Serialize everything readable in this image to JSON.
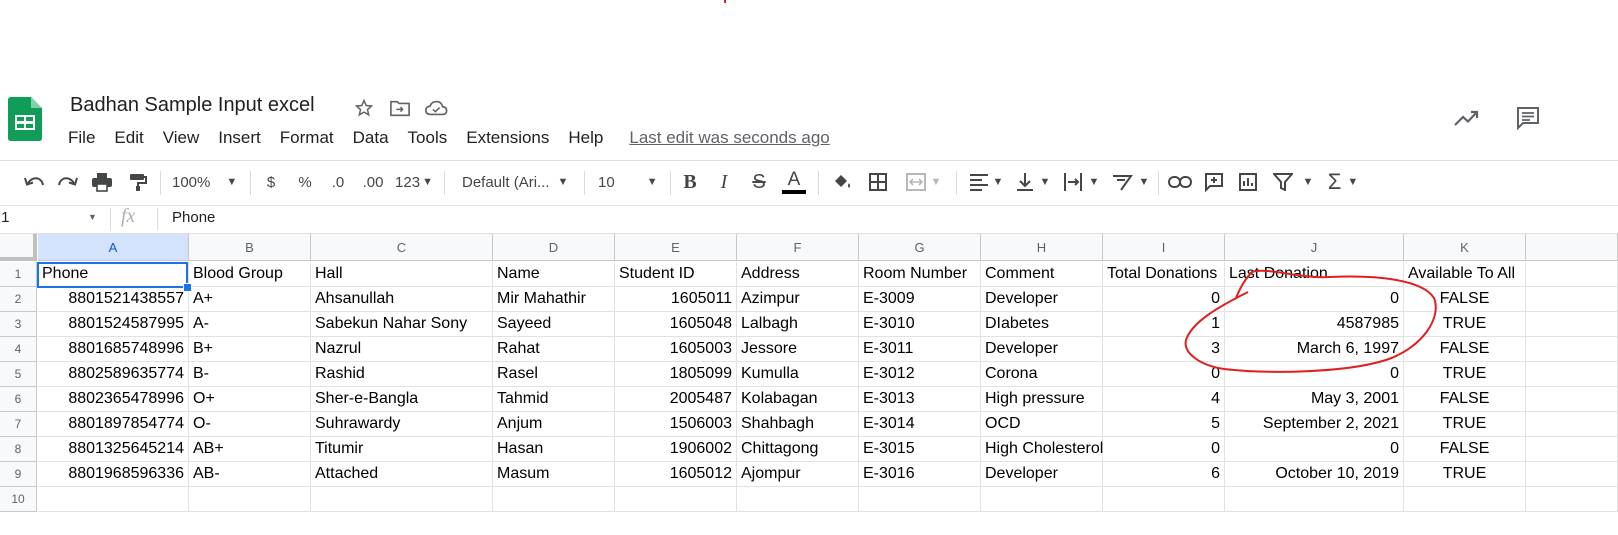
{
  "document": {
    "title": "Badhan Sample Input excel"
  },
  "menu": {
    "items": [
      "File",
      "Edit",
      "View",
      "Insert",
      "Format",
      "Data",
      "Tools",
      "Extensions",
      "Help"
    ],
    "last_edit": "Last edit was seconds ago"
  },
  "toolbar": {
    "zoom": "100%",
    "currency": "$",
    "percent": "%",
    "decrease_decimal": ".0",
    "increase_decimal": ".00",
    "more_formats": "123",
    "font_family": "Default (Ari...",
    "font_size": "10"
  },
  "formula_bar": {
    "cell_ref": ".1",
    "fx": "fx",
    "content": "Phone"
  },
  "grid": {
    "columns": [
      "A",
      "B",
      "C",
      "D",
      "E",
      "F",
      "G",
      "H",
      "I",
      "J",
      "K"
    ],
    "rows": [
      {
        "n": "1",
        "cells": [
          "Phone",
          "Blood Group",
          "Hall",
          "Name",
          "Student ID",
          "Address",
          "Room Number",
          "Comment",
          "Total Donations",
          "Last Donation",
          "Available To All"
        ]
      },
      {
        "n": "2",
        "cells": [
          "8801521438557",
          "A+",
          "Ahsanullah",
          "Mir Mahathir",
          "1605011",
          "Azimpur",
          "E-3009",
          "Developer",
          "0",
          "0",
          "FALSE"
        ]
      },
      {
        "n": "3",
        "cells": [
          "8801524587995",
          "A-",
          "Sabekun Nahar Sony",
          "Sayeed",
          "1605048",
          "Lalbagh",
          "E-3010",
          "DIabetes",
          "1",
          "4587985",
          "TRUE"
        ]
      },
      {
        "n": "4",
        "cells": [
          "8801685748996",
          "B+",
          "Nazrul",
          "Rahat",
          "1605003",
          "Jessore",
          "E-3011",
          "Developer",
          "3",
          "March 6, 1997",
          "FALSE"
        ]
      },
      {
        "n": "5",
        "cells": [
          "8802589635774",
          "B-",
          "Rashid",
          "Rasel",
          "1805099",
          "Kumulla",
          "E-3012",
          "Corona",
          "0",
          "0",
          "TRUE"
        ]
      },
      {
        "n": "6",
        "cells": [
          "8802365478996",
          "O+",
          "Sher-e-Bangla",
          "Tahmid",
          "2005487",
          "Kolabagan",
          "E-3013",
          "High pressure",
          "4",
          "May 3, 2001",
          "FALSE"
        ]
      },
      {
        "n": "7",
        "cells": [
          "8801897854774",
          "O-",
          "Suhrawardy",
          "Anjum",
          "1506003",
          "Shahbagh",
          "E-3014",
          "OCD",
          "5",
          "September 2, 2021",
          "TRUE"
        ]
      },
      {
        "n": "8",
        "cells": [
          "8801325645214",
          "AB+",
          "Titumir",
          "Hasan",
          "1906002",
          "Chittagong",
          "E-3015",
          "High Cholesterol",
          "0",
          "0",
          "FALSE"
        ]
      },
      {
        "n": "9",
        "cells": [
          "8801968596336",
          "AB-",
          "Attached",
          "Masum",
          "1605012",
          "Ajompur",
          "E-3016",
          "Developer",
          "6",
          "October 10, 2019",
          "TRUE"
        ]
      },
      {
        "n": "10",
        "cells": [
          "",
          "",
          "",
          "",
          "",
          "",
          "",
          "",
          "",
          "",
          ""
        ]
      }
    ]
  },
  "colors": {
    "sheets_green": "#0f9d58",
    "selection_blue": "#1a73e8",
    "annotation_red": "#e02020"
  },
  "icons": [
    "undo-icon",
    "redo-icon",
    "print-icon",
    "paint-format-icon",
    "bold-icon",
    "italic-icon",
    "strikethrough-icon",
    "text-color-icon",
    "fill-color-icon",
    "borders-icon",
    "merge-icon",
    "align-icon",
    "valign-icon",
    "wrap-icon",
    "rotate-icon",
    "link-icon",
    "comment-icon",
    "chart-icon",
    "filter-icon",
    "functions-icon",
    "star-icon",
    "move-icon",
    "cloud-status-icon",
    "explore-icon",
    "comments-icon"
  ]
}
